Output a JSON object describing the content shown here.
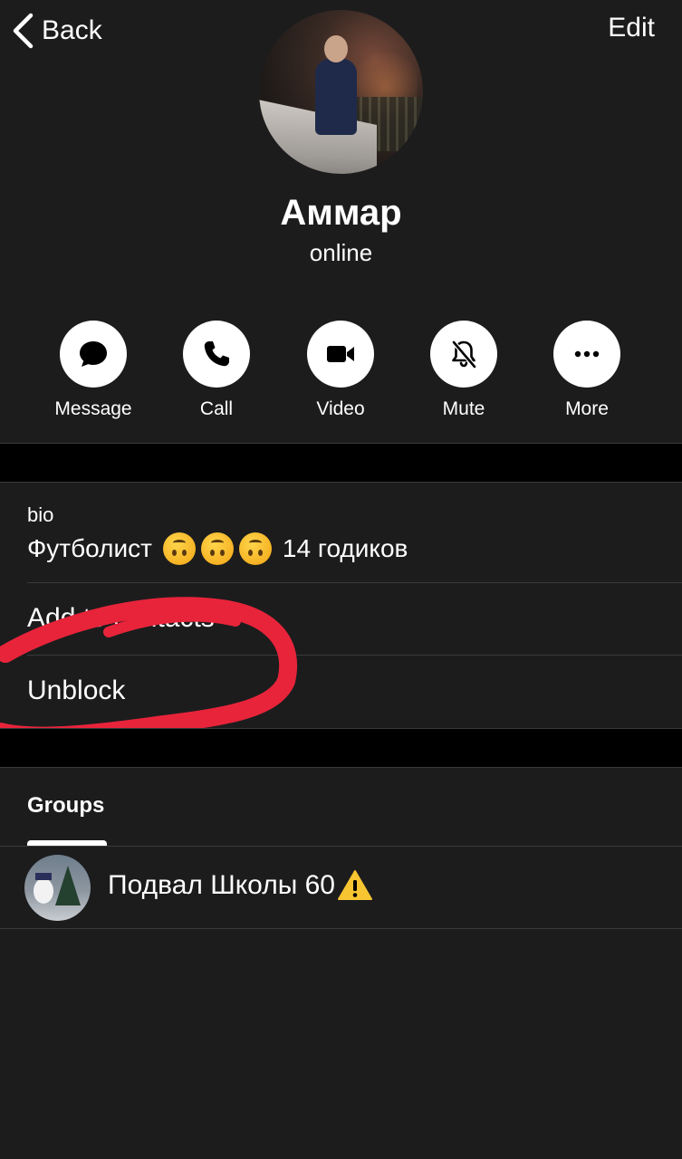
{
  "header": {
    "back_label": "Back",
    "edit_label": "Edit"
  },
  "profile": {
    "name": "Аммар",
    "status": "online"
  },
  "actions": [
    {
      "label": "Message",
      "icon": "message-bubble-icon"
    },
    {
      "label": "Call",
      "icon": "phone-icon"
    },
    {
      "label": "Video",
      "icon": "video-camera-icon"
    },
    {
      "label": "Mute",
      "icon": "bell-slash-icon"
    },
    {
      "label": "More",
      "icon": "ellipsis-icon"
    }
  ],
  "info": {
    "bio_label": "bio",
    "bio_text_prefix": "Футболист",
    "bio_emoji": "upside-down-face-emoji",
    "bio_text_suffix": "14 годиков",
    "add_to_contacts": "Add to contacts",
    "unblock": "Unblock"
  },
  "tabs": {
    "groups_label": "Groups"
  },
  "groups": [
    {
      "name": "Подвал Школы 60",
      "badge_icon": "warning-icon"
    }
  ],
  "colors": {
    "background": "#1c1c1d",
    "separator_block": "#000000",
    "annotation_red": "#e8243a",
    "warning_yellow": "#f7c531"
  }
}
